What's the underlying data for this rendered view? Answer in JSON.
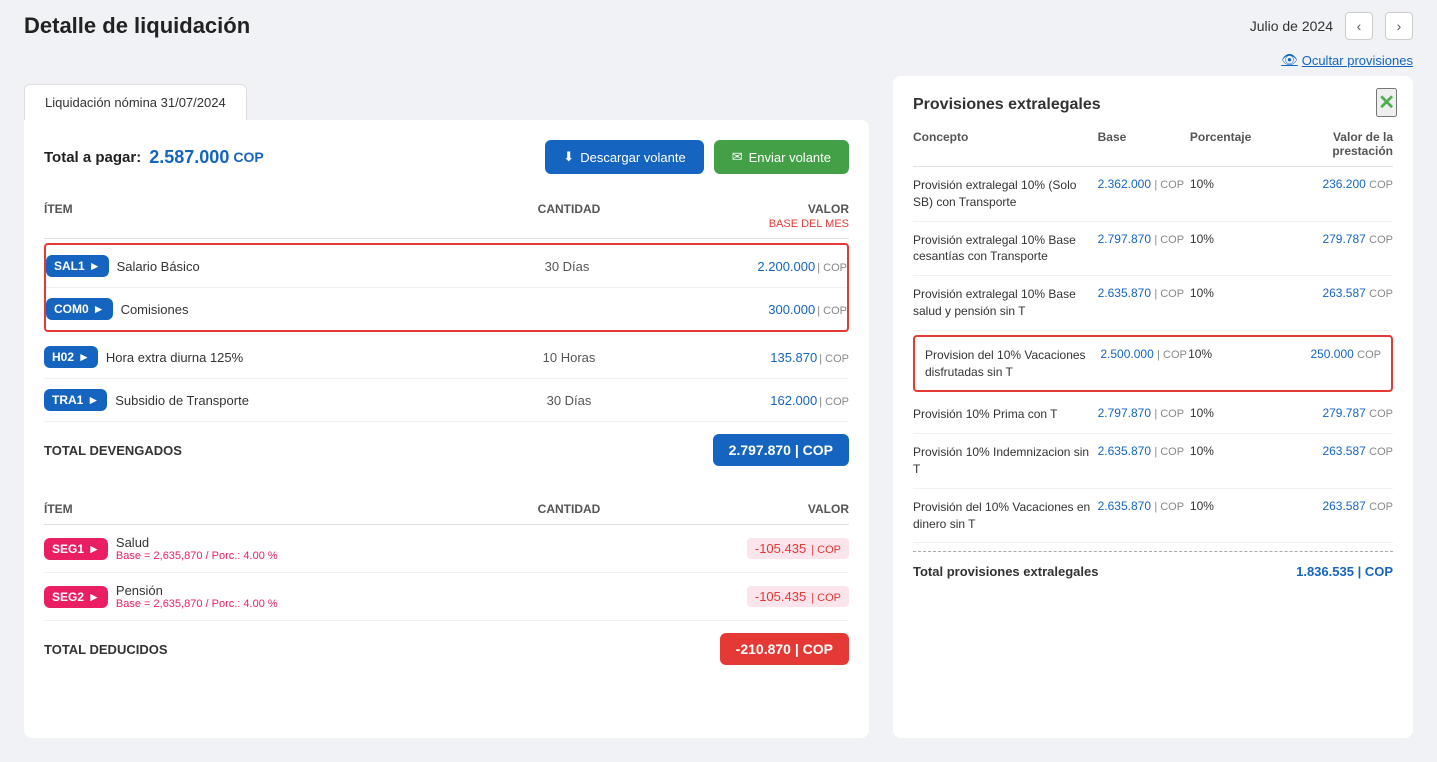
{
  "header": {
    "title": "Detalle de liquidación",
    "month": "Julio de 2024",
    "ocultar_label": "Ocultar provisiones"
  },
  "tab": {
    "label": "Liquidación nómina 31/07/2024"
  },
  "summary": {
    "total_label": "Total a pagar:",
    "total_amount": "2.587.000",
    "currency": "COP"
  },
  "buttons": {
    "download": "Descargar volante",
    "send": "Enviar volante"
  },
  "devengados_table": {
    "col_item": "ÍTEM",
    "col_qty": "CANTIDAD",
    "col_val": "VALOR",
    "base_mes": "Base del mes",
    "rows": [
      {
        "badge": "SAL1",
        "badge_color": "blue",
        "name": "Salario Básico",
        "qty": "30 Días",
        "value": "2.200.000",
        "currency": "COP",
        "highlighted": true,
        "sub": ""
      },
      {
        "badge": "COM0",
        "badge_color": "blue",
        "name": "Comisiones",
        "qty": "",
        "value": "300.000",
        "currency": "COP",
        "highlighted": true,
        "sub": ""
      },
      {
        "badge": "H02",
        "badge_color": "blue",
        "name": "Hora extra diurna 125%",
        "qty": "10 Horas",
        "value": "135.870",
        "currency": "COP",
        "highlighted": false,
        "sub": ""
      },
      {
        "badge": "TRA1",
        "badge_color": "blue",
        "name": "Subsidio de Transporte",
        "qty": "30 Días",
        "value": "162.000",
        "currency": "COP",
        "highlighted": false,
        "sub": ""
      }
    ],
    "total_label": "TOTAL DEVENGADOS",
    "total_value": "2.797.870",
    "total_currency": "COP"
  },
  "deducidos_table": {
    "col_item": "ÍTEM",
    "col_qty": "CANTIDAD",
    "col_val": "VALOR",
    "rows": [
      {
        "badge": "SEG1",
        "badge_color": "pink",
        "name": "Salud",
        "sub": "Base = 2,635,870 / Porc.: 4.00 %",
        "qty": "",
        "value": "-105.435",
        "currency": "COP",
        "negative": true
      },
      {
        "badge": "SEG2",
        "badge_color": "pink",
        "name": "Pensión",
        "sub": "Base = 2,635,870 / Porc.: 4.00 %",
        "qty": "",
        "value": "-105.435",
        "currency": "COP",
        "negative": true
      }
    ],
    "total_label": "TOTAL DEDUCIDOS",
    "total_value": "-210.870",
    "total_currency": "COP"
  },
  "provisiones": {
    "title": "Provisiones extralegales",
    "col_concepto": "Concepto",
    "col_base": "Base",
    "col_porcentaje": "Porcentaje",
    "col_valor": "Valor de la prestación",
    "rows": [
      {
        "concepto": "Provisión extralegal 10% (Solo SB) con Transporte",
        "base": "2.362.000",
        "base_currency": "COP",
        "porcentaje": "10%",
        "valor": "236.200",
        "valor_currency": "COP",
        "highlighted": false
      },
      {
        "concepto": "Provisión extralegal 10% Base cesantías con Transporte",
        "base": "2.797.870",
        "base_currency": "COP",
        "porcentaje": "10%",
        "valor": "279.787",
        "valor_currency": "COP",
        "highlighted": false
      },
      {
        "concepto": "Provisión extralegal 10% Base salud y pensión sin T",
        "base": "2.635.870",
        "base_currency": "COP",
        "porcentaje": "10%",
        "valor": "263.587",
        "valor_currency": "COP",
        "highlighted": false
      },
      {
        "concepto": "Provision del 10% Vacaciones disfrutadas sin T",
        "base": "2.500.000",
        "base_currency": "COP",
        "porcentaje": "10%",
        "valor": "250.000",
        "valor_currency": "COP",
        "highlighted": true
      },
      {
        "concepto": "Provisión 10% Prima con T",
        "base": "2.797.870",
        "base_currency": "COP",
        "porcentaje": "10%",
        "valor": "279.787",
        "valor_currency": "COP",
        "highlighted": false
      },
      {
        "concepto": "Provisión 10% Indemnizacion sin T",
        "base": "2.635.870",
        "base_currency": "COP",
        "porcentaje": "10%",
        "valor": "263.587",
        "valor_currency": "COP",
        "highlighted": false
      },
      {
        "concepto": "Provisión del 10% Vacaciones en dinero sin T",
        "base": "2.635.870",
        "base_currency": "COP",
        "porcentaje": "10%",
        "valor": "263.587",
        "valor_currency": "COP",
        "highlighted": false
      }
    ],
    "total_label": "Total provisiones extralegales",
    "total_value": "1.836.535",
    "total_currency": "COP"
  }
}
